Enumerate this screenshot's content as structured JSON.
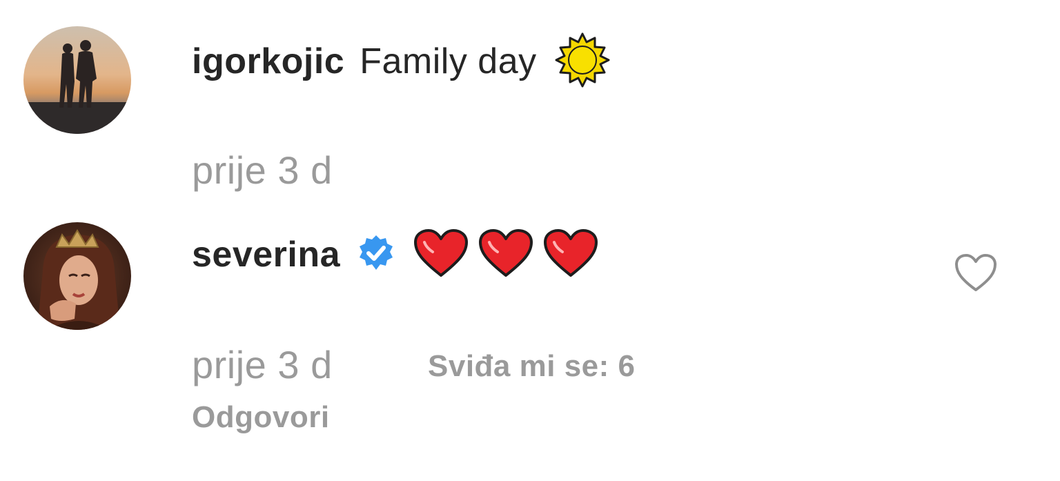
{
  "comments": [
    {
      "username": "igorkojic",
      "text": "Family day",
      "emoji_icon": "sun-emoji-icon",
      "time": "prije 3 d"
    },
    {
      "username": "severina",
      "verified_icon": "verified-badge-icon",
      "emoji_icons": [
        "red-heart-emoji-icon",
        "red-heart-emoji-icon",
        "red-heart-emoji-icon"
      ],
      "time": "prije 3 d",
      "likes": "Sviđa mi se: 6",
      "reply": "Odgovori",
      "like_icon": "heart-outline-icon"
    }
  ],
  "colors": {
    "text": "#262626",
    "secondary": "#9a9a9a",
    "verified": "#3897f0",
    "heart": "#e8242a",
    "sun": "#f5d800"
  }
}
